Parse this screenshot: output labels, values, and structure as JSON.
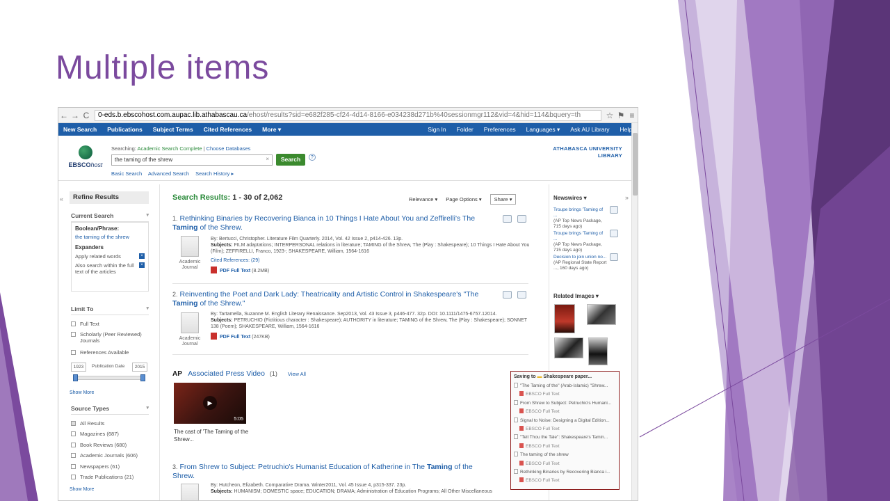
{
  "slide": {
    "title": "Multiple items"
  },
  "browser": {
    "back": "←",
    "forward": "→",
    "reload": "C",
    "url_domain": "0-eds.b.ebscohost.com.aupac.lib.athabascau.ca",
    "url_rest": "/ehost/results?sid=e682f285-cf24-4d14-8166-e034238d271b%40sessionmgr112&vid=4&hid=114&bquery=th"
  },
  "topnav": {
    "left": [
      "New Search",
      "Publications",
      "Subject Terms",
      "Cited References",
      "More ▾"
    ],
    "right": [
      "Sign In",
      "Folder",
      "Preferences",
      "Languages ▾",
      "Ask AU Library",
      "Help"
    ]
  },
  "search": {
    "logo_text": "EBSCO",
    "logo_italic": "host",
    "searching_label": "Searching:",
    "database": "Academic Search Complete",
    "choose": "Choose Databases",
    "query": "the taming of the shrew",
    "clear": "×",
    "button": "Search",
    "help": "?",
    "links": [
      "Basic Search",
      "Advanced Search",
      "Search History ▸"
    ],
    "library_line1": "ATHABASCA UNIVERSITY",
    "library_line2": "LIBRARY"
  },
  "sidebar": {
    "collapse": "«",
    "refine": "Refine Results",
    "current_search": "Current Search",
    "boolean_label": "Boolean/Phrase:",
    "boolean_value": "the taming of the shrew",
    "expanders_label": "Expanders",
    "expanders": [
      "Apply related words",
      "Also search within the full text of the articles"
    ],
    "limit_to": "Limit To",
    "limits": [
      "Full Text",
      "Scholarly (Peer Reviewed) Journals",
      "References Available"
    ],
    "pub_from": "1923",
    "pub_label": "Publication Date",
    "pub_to": "2015",
    "show_more": "Show More",
    "source_types": "Source Types",
    "sources": [
      {
        "label": "All Results",
        "count": "",
        "checked": true
      },
      {
        "label": "Magazines",
        "count": "(687)",
        "checked": false
      },
      {
        "label": "Book Reviews",
        "count": "(680)",
        "checked": false
      },
      {
        "label": "Academic Journals",
        "count": "(606)",
        "checked": false
      },
      {
        "label": "Newspapers",
        "count": "(61)",
        "checked": false
      },
      {
        "label": "Trade Publications",
        "count": "(21)",
        "checked": false
      }
    ]
  },
  "results": {
    "heading": "Search Results:",
    "count": "1 - 30 of 2,062",
    "relevance": "Relevance ▾",
    "page_options": "Page Options ▾",
    "share": "Share ▾",
    "doc_type": "Academic Journal",
    "items": [
      {
        "num": "1.",
        "title_pre": "Rethinking Binaries by Recovering Bianca in 10 Things I Hate About You and Zeffirelli's The ",
        "title_bold": "Taming",
        "title_post": " of the Shrew.",
        "by": "By: Bertucci, Christopher. Literature Film Quarterly. 2014, Vol. 42 Issue 2, p414-426. 13p.",
        "subjects": "FILM adaptations; INTERPERSONAL relations in literature; TAMING of the Shrew, The (Play : Shakespeare); 10 Things I Hate About You (Film); ZEFFIRELLI, Franco, 1923-; SHAKESPEARE, William, 1564-1616",
        "cited": "Cited References: (29)",
        "pdf": "PDF Full Text",
        "size": "(8.2MB)"
      },
      {
        "num": "2.",
        "title_pre": "Reinventing the Poet and Dark Lady: Theatricality and Artistic Control in Shakespeare's \"The ",
        "title_bold": "Taming",
        "title_post": " of the Shrew.\"",
        "by": "By: Tartamella, Suzanne M. English Literary Renaissance. Sep2013, Vol. 43 Issue 3, p446-477. 32p. DOI: 10.1111/1475-6757.12014.",
        "subjects": "PETRUCHIO (Fictitious character : Shakespeare); AUTHORITY in literature; TAMING of the Shrew, The (Play : Shakespeare); SONNET 138 (Poem); SHAKESPEARE, William, 1564-1616",
        "cited": "",
        "pdf": "PDF Full Text",
        "size": "(247KB)"
      },
      {
        "num": "3.",
        "title_pre": "From Shrew to Subject: Petruchio's Humanist Education of Katherine in The ",
        "title_bold": "Taming",
        "title_post": " of the Shrew.",
        "by": "By: Hutcheon, Elizabeth. Comparative Drama. Winter2011, Vol. 45 Issue 4, p315-337. 23p.",
        "subjects": "HUMANISM; DOMESTIC space; EDUCATION; DRAMA; Administration of Education Programs; All Other Miscellaneous",
        "cited": "",
        "pdf": "",
        "size": ""
      }
    ],
    "subjects_label": "Subjects:",
    "ap_logo": "AP",
    "ap_title": "Associated Press Video",
    "ap_count": "(1)",
    "ap_view_all": "View All",
    "video_duration": "5:05",
    "video_caption": "The cast of 'The Taming of the Shrew...",
    "play": "▶"
  },
  "right": {
    "collapse": "»",
    "newswires": "Newswires ▾",
    "news": [
      {
        "title": "Troupe brings 'Taming of ...",
        "meta": "(AP Top News Package, 715 days ago)"
      },
      {
        "title": "Troupe brings 'Taming of ...",
        "meta": "(AP Top News Package, 715 days ago)"
      },
      {
        "title": "Decision to join union no...",
        "meta": "(AP Regional State Report ..., 160 days ago)"
      }
    ],
    "related_images": "Related Images ▾"
  },
  "folder": {
    "saving_to": "Saving to",
    "folder_name": "Shakespeare paper...",
    "items": [
      {
        "text": "\"The Taming of the\" (Arab-Islamic) \"Shrew...",
        "sub": false
      },
      {
        "text": "EBSCO Full Text",
        "sub": true
      },
      {
        "text": "From Shrew to Subject: Petruchio's Humani...",
        "sub": false
      },
      {
        "text": "EBSCO Full Text",
        "sub": true
      },
      {
        "text": "Signal to Noise: Designing a Digital Edition...",
        "sub": false
      },
      {
        "text": "EBSCO Full Text",
        "sub": true
      },
      {
        "text": "\"Tell Thou the Tale\": Shakespeare's Tamin...",
        "sub": false
      },
      {
        "text": "EBSCO Full Text",
        "sub": true
      },
      {
        "text": "The taming of the shrew",
        "sub": false
      },
      {
        "text": "EBSCO Full Text",
        "sub": true
      },
      {
        "text": "Rethinking Binaries by Recovering Bianca i...",
        "sub": false
      },
      {
        "text": "EBSCO Full Text",
        "sub": true
      }
    ]
  },
  "colors": {
    "slide_title": "#7b4a9e",
    "nav_blue": "#1e5ea8",
    "search_green": "#3b8a2e",
    "folder_border": "#8b1a1a"
  }
}
